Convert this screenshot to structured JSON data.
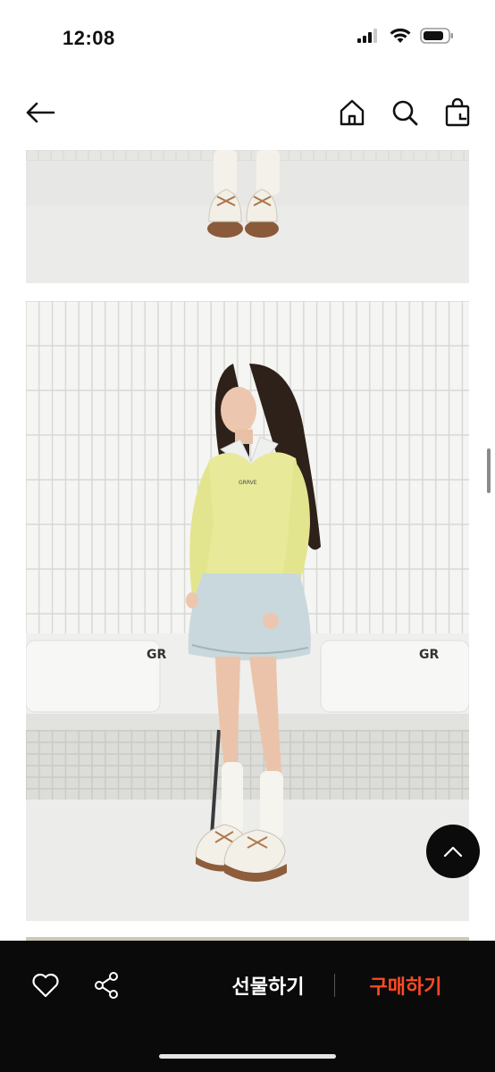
{
  "status_bar": {
    "time": "12:08",
    "icons": [
      "signal-icon",
      "wifi-icon",
      "battery-icon"
    ]
  },
  "nav": {
    "icons": [
      "back-arrow-icon",
      "home-icon",
      "search-icon",
      "shopping-bag-icon"
    ]
  },
  "gallery": {
    "images": [
      "product-photo-shoes",
      "product-photo-model-full",
      "product-photo-next"
    ]
  },
  "scroll_top": {
    "icon": "chevron-up-icon"
  },
  "bottom_bar": {
    "gift_label": "선물하기",
    "buy_label": "구매하기",
    "icons": [
      "heart-icon",
      "share-icon"
    ],
    "colors": {
      "background": "#0a0a0a",
      "buy": "#ff4a23",
      "gift": "#ffffff"
    }
  }
}
